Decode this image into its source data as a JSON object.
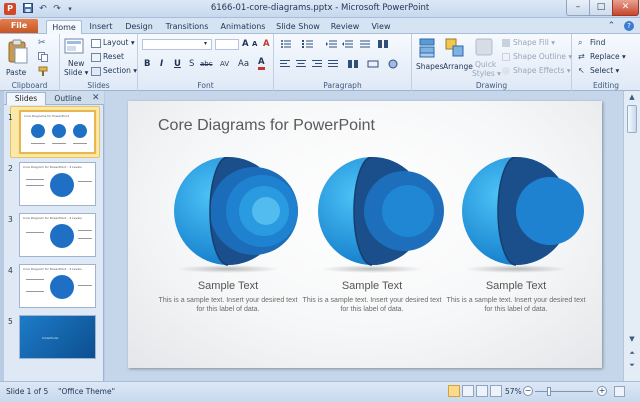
{
  "window": {
    "app_icon_letter": "P",
    "title": "6166-01-core-diagrams.pptx - Microsoft PowerPoint",
    "qat": {
      "save_icon": "save-icon",
      "undo_icon": "undo-icon",
      "redo_icon": "redo-icon",
      "customize_icon": "qat-dropdown-icon"
    },
    "minimize_symbol": "–",
    "maximize_symbol": "□",
    "close_symbol": "✕"
  },
  "ribbon_tabs": [
    "File",
    "Home",
    "Insert",
    "Design",
    "Transitions",
    "Animations",
    "Slide Show",
    "Review",
    "View"
  ],
  "ribbon_right_icons": [
    "minimize-ribbon-icon",
    "help-icon"
  ],
  "ribbon": {
    "clipboard": {
      "label": "Clipboard",
      "paste": "Paste",
      "cut_icon": "cut-icon",
      "copy_icon": "copy-icon",
      "format_painter_icon": "format-painter-icon"
    },
    "slides": {
      "label": "Slides",
      "new_slide_line1": "New",
      "new_slide_line2": "Slide ▾",
      "layout": "Layout ▾",
      "reset": "Reset",
      "section": "Section ▾"
    },
    "font": {
      "label": "Font",
      "font_name": "",
      "font_size": "",
      "grow": "A",
      "shrink": "A",
      "clear": "A",
      "bold": "B",
      "italic": "I",
      "underline": "U",
      "strike": "S",
      "abc": "abc",
      "spacing": "AV",
      "case": "Aa",
      "color": "A"
    },
    "paragraph": {
      "label": "Paragraph"
    },
    "drawing": {
      "label": "Drawing",
      "shapes": "Shapes",
      "arrange": "Arrange",
      "quick_styles_line1": "Quick",
      "quick_styles_line2": "Styles ▾",
      "shape_fill": "Shape Fill ▾",
      "shape_outline": "Shape Outline ▾",
      "shape_effects": "Shape Effects ▾"
    },
    "editing": {
      "label": "Editing",
      "find": "Find",
      "replace": "Replace ▾",
      "select": "Select ▾"
    }
  },
  "slides_pane": {
    "tab_slides": "Slides",
    "tab_outline": "Outline",
    "close_symbol": "✕",
    "thumbnails": [
      {
        "number": "1",
        "title": "Core Diagrams for PowerPoint",
        "selected": true
      },
      {
        "number": "2",
        "title": "Core Diagram for PowerPoint - 4 Levels",
        "selected": false
      },
      {
        "number": "3",
        "title": "Core Diagram for PowerPoint - 4 Levels",
        "selected": false
      },
      {
        "number": "4",
        "title": "Core Diagram for PowerPoint - 4 Levels",
        "selected": false
      },
      {
        "number": "5",
        "title": "SlideModel",
        "selected": false
      }
    ]
  },
  "slide": {
    "title": "Core Diagrams for PowerPoint",
    "diagrams": [
      {
        "heading": "Sample Text",
        "body": "This is a sample text. Insert your desired text for this label of data."
      },
      {
        "heading": "Sample Text",
        "body": "This is a sample text. Insert your desired text for this label of data."
      },
      {
        "heading": "Sample Text",
        "body": "This is a sample text. Insert your desired text for this label of data."
      }
    ]
  },
  "scrollbar": {
    "up": "▲",
    "down": "▼",
    "prev_slide": "⏶",
    "next_slide": "⏷"
  },
  "status": {
    "slide_info": "Slide 1 of 5",
    "theme": "\"Office Theme\"",
    "zoom": "57%",
    "zoom_out": "−",
    "zoom_in": "+",
    "fit_icon": "fit-to-window-icon",
    "view_icons": [
      "normal-view-icon",
      "slide-sorter-view-icon",
      "reading-view-icon",
      "slideshow-view-icon"
    ]
  },
  "colors": {
    "file_tab": "#c55221",
    "sphere_light": "#1ea7ee",
    "sphere_mid": "#1274c4",
    "sphere_dark": "#1a4f8c",
    "thumb_highlight": "#e7b84d"
  }
}
